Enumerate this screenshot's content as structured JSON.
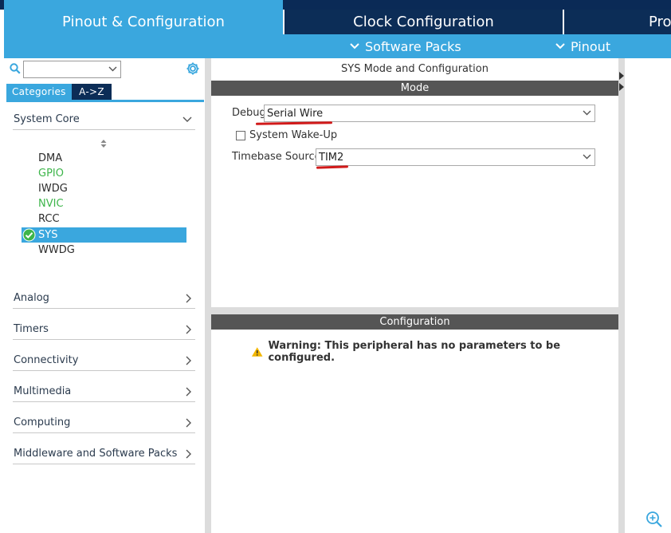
{
  "tabs": {
    "pinout": "Pinout & Configuration",
    "clock": "Clock Configuration",
    "project": "Project Manager"
  },
  "subbar": {
    "software_packs": "Software Packs",
    "pinout": "Pinout"
  },
  "sidebar": {
    "search_value": "",
    "tab_categories": "Categories",
    "tab_az": "A->Z",
    "groups": {
      "system_core": "System Core",
      "analog": "Analog",
      "timers": "Timers",
      "connectivity": "Connectivity",
      "multimedia": "Multimedia",
      "computing": "Computing",
      "middleware": "Middleware and Software Packs"
    },
    "items": [
      "DMA",
      "GPIO",
      "IWDG",
      "NVIC",
      "RCC",
      "SYS",
      "WWDG"
    ],
    "item_colors": {
      "DMA": "#2b2b2b",
      "GPIO": "#3db54a",
      "IWDG": "#2b2b2b",
      "NVIC": "#3db54a",
      "RCC": "#2b2b2b",
      "SYS": "#ffffff",
      "WWDG": "#2b2b2b"
    },
    "selected_item": "SYS"
  },
  "main": {
    "title": "SYS Mode and Configuration",
    "mode_header": "Mode",
    "debug_label": "Debug",
    "debug_value": "Serial Wire",
    "wakeup_label": "System Wake-Up",
    "wakeup_checked": false,
    "timebase_label": "Timebase Source",
    "timebase_value": "TIM2",
    "config_header": "Configuration",
    "warning": "Warning: This peripheral has no parameters to be configured."
  },
  "colors": {
    "accent": "#3aa7de",
    "navy": "#0c2d57",
    "section_bar": "#555555",
    "annotation_red": "#d11a1a",
    "enabled_green": "#3db54a",
    "warning_yellow": "#f2b600"
  },
  "icons": [
    "search-icon",
    "gear-icon",
    "chevron-down-icon",
    "chevron-right-icon",
    "check-circle-icon",
    "warning-icon",
    "zoom-in-icon",
    "sort-icon"
  ]
}
